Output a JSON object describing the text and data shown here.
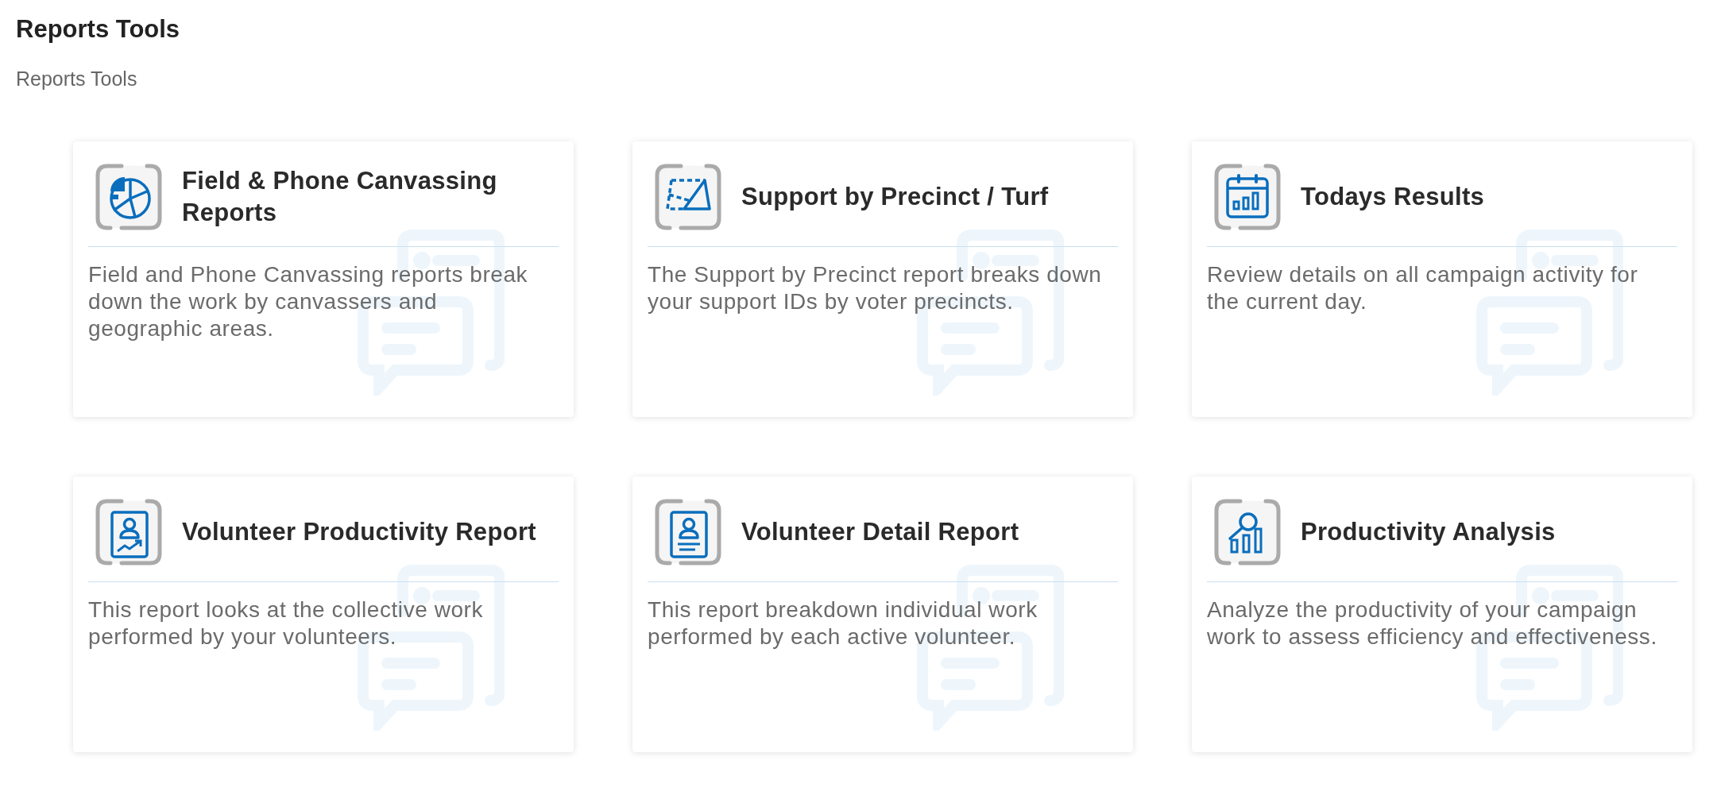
{
  "page": {
    "title": "Reports Tools",
    "subtitle": "Reports Tools"
  },
  "cards": [
    {
      "title": "Field & Phone Canvassing Reports",
      "description": "Field and Phone Canvassing reports break down the work by canvassers and geographic areas."
    },
    {
      "title": "Support by Precinct / Turf",
      "description": "The Support by Precinct report breaks down your support IDs by voter precincts."
    },
    {
      "title": "Todays Results",
      "description": "Review details on all campaign activity for the current day."
    },
    {
      "title": "Volunteer Productivity Report",
      "description": "This report looks at the collective work performed by your volunteers."
    },
    {
      "title": "Volunteer Detail Report",
      "description": "This report breakdown individual work performed by each active volunteer."
    },
    {
      "title": "Productivity Analysis",
      "description": "Analyze the productivity of your campaign work to assess efficiency and effectiveness."
    }
  ]
}
